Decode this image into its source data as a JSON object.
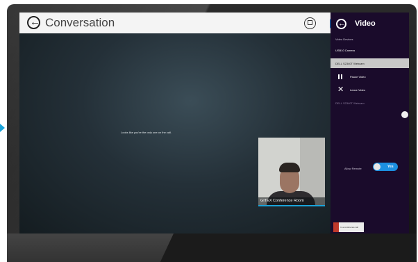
{
  "app": {
    "window_title": "Conversation"
  },
  "conversation": {
    "empty_message": "Looks like you're the only one on the call.",
    "self_view_caption": "GITEX Conference Room"
  },
  "video_panel": {
    "title": "Video",
    "devices_label": "Video Devices",
    "devices": [
      {
        "label": "USB10 Camera",
        "selected": false
      },
      {
        "label": "DELL S2340T Webcam",
        "selected": true
      }
    ],
    "actions": [
      {
        "label": "Pause Video",
        "icon": "pause-icon"
      },
      {
        "label": "Leave Video",
        "icon": "close-icon"
      }
    ],
    "current_device": "DELL S2340T Webcam",
    "allow_remote_label": "Allow Remote",
    "allow_remote_value": "Yes",
    "conference_call_label": "In a conference call"
  },
  "colors": {
    "accent_blue": "#1aa3d9",
    "toggle_blue": "#1c8fe0",
    "panel_purple": "#1a0b2b",
    "header_bg": "#f4f4f4",
    "conference_red": "#c0392b"
  }
}
